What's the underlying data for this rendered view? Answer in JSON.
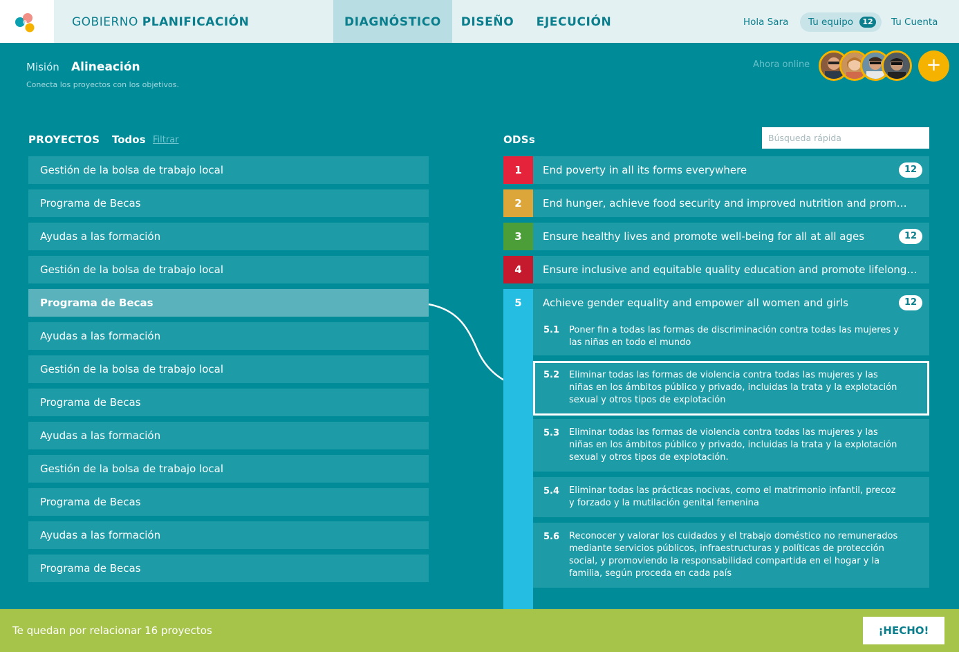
{
  "header": {
    "brand_prefix": "GOBIERNO",
    "brand_name": "PLANIFICACIÓN",
    "nav": [
      {
        "label": "DIAGNÓSTICO",
        "active": true
      },
      {
        "label": "DISEÑO",
        "active": false
      },
      {
        "label": "EJECUCIÓN",
        "active": false
      }
    ],
    "greeting": "Hola Sara",
    "team_label": "Tu equipo",
    "team_count": "12",
    "account_label": "Tu Cuenta",
    "logo_icon": "three-circles-logo-icon"
  },
  "subheader": {
    "breadcrumb_parent": "Misión",
    "breadcrumb_current": "Alineación",
    "description": "Conecta los proyectos con los objetivos.",
    "online_label": "Ahora online",
    "add_label": "+",
    "accent": "#f5b300"
  },
  "projects": {
    "title": "PROYECTOS",
    "filter_all": "Todos",
    "filter_link": "Filtrar",
    "items": [
      {
        "label": "Gestión de la bolsa de trabajo local"
      },
      {
        "label": "Programa de Becas"
      },
      {
        "label": "Ayudas a las formación"
      },
      {
        "label": "Gestión de la bolsa de trabajo local"
      },
      {
        "label": "Programa de Becas",
        "selected": true
      },
      {
        "label": "Ayudas a las formación"
      },
      {
        "label": "Gestión de la bolsa de trabajo local"
      },
      {
        "label": "Programa de Becas"
      },
      {
        "label": "Ayudas a las formación"
      },
      {
        "label": "Gestión de la bolsa de trabajo local"
      },
      {
        "label": "Programa de Becas"
      },
      {
        "label": "Ayudas a las formación"
      },
      {
        "label": "Programa de Becas"
      }
    ]
  },
  "ods": {
    "title": "ODSs",
    "search_placeholder": "Búsqueda rápida",
    "items": [
      {
        "num": "1",
        "title": "End poverty in all its forms everywhere",
        "badge": "12",
        "color": "#e5243b"
      },
      {
        "num": "2",
        "title": "End hunger, achieve food security and improved nutrition and prom…",
        "badge": "",
        "color": "#dda63a"
      },
      {
        "num": "3",
        "title": "Ensure healthy lives and promote well-being for all at all ages",
        "badge": "12",
        "color": "#4c9f38"
      },
      {
        "num": "4",
        "title": "Ensure inclusive and equitable quality education and promote lifelong…",
        "badge": "",
        "color": "#c5192d"
      },
      {
        "num": "5",
        "title": "Achieve gender equality and empower all women and girls",
        "badge": "12",
        "color": "#26bde2"
      }
    ],
    "targets": [
      {
        "num": "5.1",
        "text": "Poner fin a todas las formas de discriminación contra todas las mujeres y las niñas en todo el mundo"
      },
      {
        "num": "5.2",
        "text": "Eliminar todas las formas de violencia contra todas las mujeres y las niñas en los ámbitos público y privado, incluidas la trata y la explotación sexual y otros tipos de explotación",
        "selected": true
      },
      {
        "num": "5.3",
        "text": "Eliminar todas las formas de violencia contra todas las mujeres y las niñas en los ámbitos público y privado, incluidas la trata y la explotación sexual y otros tipos de explotación."
      },
      {
        "num": "5.4",
        "text": "Eliminar todas las prácticas nocivas, como el matrimonio infantil, precoz y forzado y la mutilación genital femenina"
      },
      {
        "num": "5.6",
        "text": "Reconocer y valorar los cuidados y el trabajo doméstico no remunerados mediante servicios públicos, infraestructuras y políticas de protección social, y promoviendo la responsabilidad compartida en el hogar y la familia, según proceda en cada país"
      }
    ]
  },
  "footer": {
    "message": "Te quedan por relacionar 16 proyectos",
    "done_label": "¡HECHO!"
  }
}
